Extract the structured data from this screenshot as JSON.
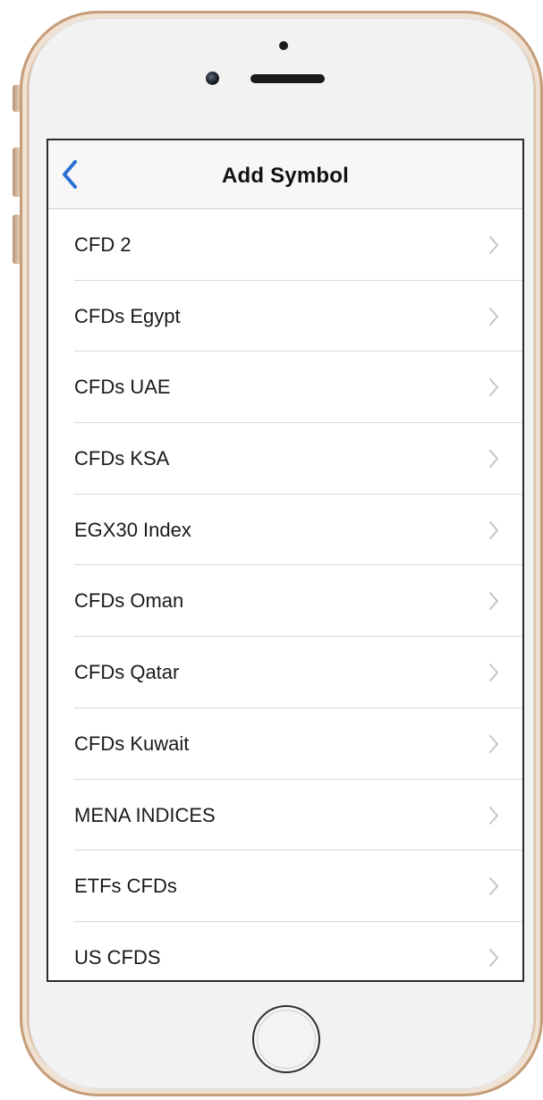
{
  "device": {
    "frame_color": "#d9b793",
    "accent_color": "#2a6fd6"
  },
  "navbar": {
    "title": "Add Symbol",
    "back_icon": "chevron-left-icon"
  },
  "list": {
    "chevron_icon": "chevron-right-icon",
    "items": [
      {
        "label": "CFD 2"
      },
      {
        "label": "CFDs Egypt"
      },
      {
        "label": "CFDs UAE"
      },
      {
        "label": "CFDs KSA"
      },
      {
        "label": "EGX30 Index"
      },
      {
        "label": "CFDs Oman"
      },
      {
        "label": "CFDs Qatar"
      },
      {
        "label": "CFDs Kuwait"
      },
      {
        "label": "MENA INDICES"
      },
      {
        "label": "ETFs CFDs"
      },
      {
        "label": "US CFDS"
      }
    ]
  }
}
